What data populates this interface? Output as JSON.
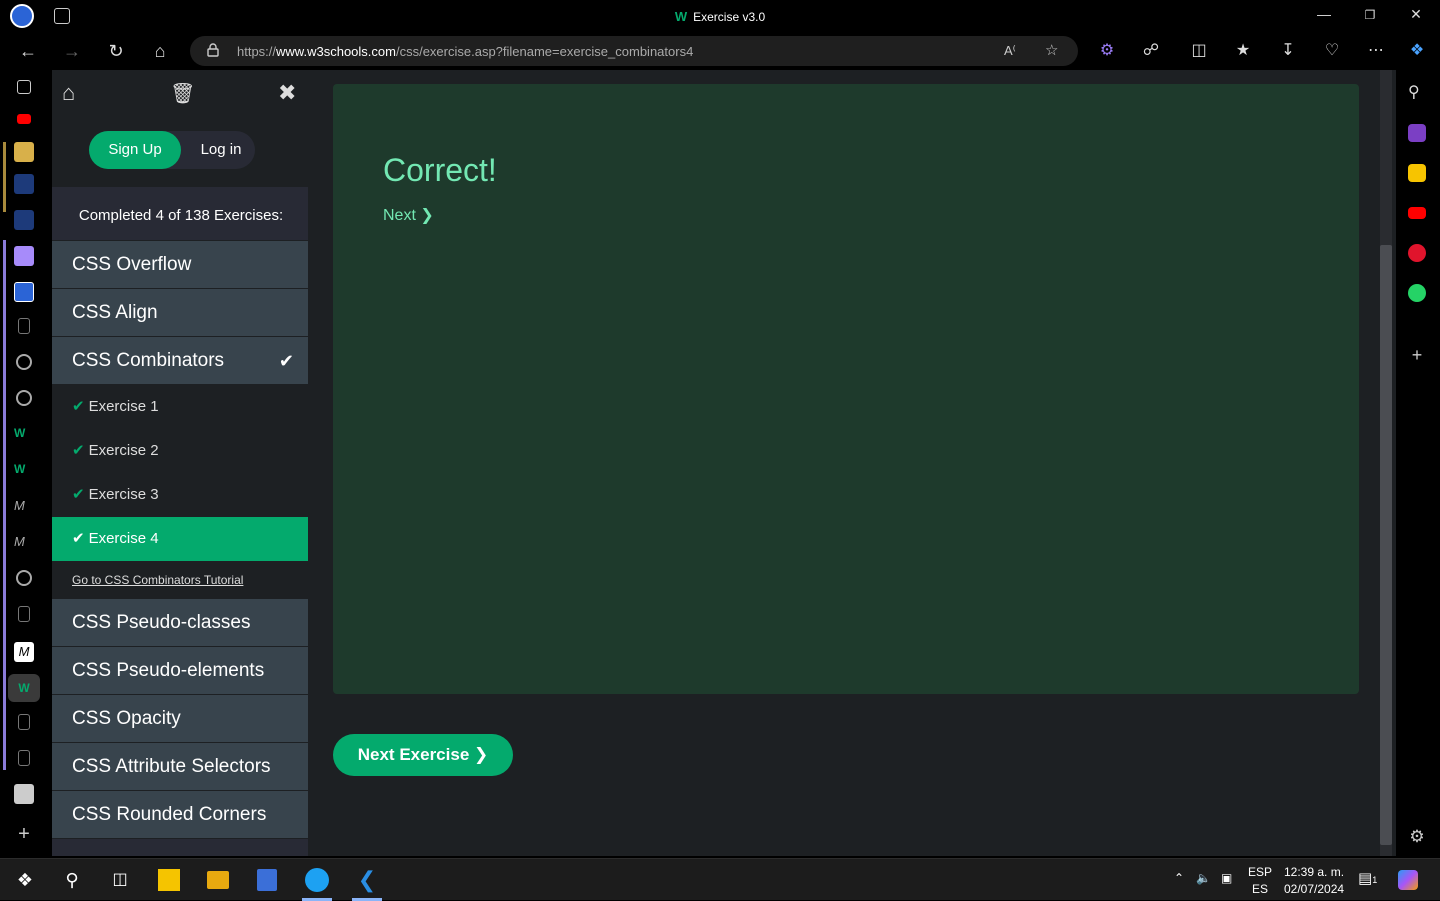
{
  "window": {
    "title": "Exercise v3.0",
    "logo_text": "W"
  },
  "address": {
    "url_prefix": "https://",
    "url_host": "www.w3schools.com",
    "url_path": "/css/exercise.asp?filename=exercise_combinators4"
  },
  "menu": {
    "sign_up": "Sign Up",
    "log_in": "Log in",
    "progress": "Completed 4 of 138 Exercises:",
    "topics_before": [
      "CSS Overflow",
      "CSS Align"
    ],
    "current_topic": "CSS Combinators",
    "exercises": [
      "Exercise 1",
      "Exercise 2",
      "Exercise 3",
      "Exercise 4"
    ],
    "tutorial_link": "Go to CSS Combinators Tutorial",
    "topics_after": [
      "CSS Pseudo-classes",
      "CSS Pseudo-elements",
      "CSS Opacity",
      "CSS Attribute Selectors",
      "CSS Rounded Corners"
    ]
  },
  "result": {
    "heading": "Correct!",
    "next_label": "Next ❯"
  },
  "next_exercise_label": "Next Exercise ❯",
  "taskbar": {
    "lang_top": "ESP",
    "lang_bottom": "ES",
    "time": "12:39 a. m.",
    "date": "02/07/2024",
    "notification_count": "1"
  },
  "colors": {
    "accent": "#04aa6d",
    "menu_bg": "#282a35",
    "topic_bg": "#38444d",
    "result_bg": "#1e3a2c",
    "result_text": "#73e8b3"
  }
}
